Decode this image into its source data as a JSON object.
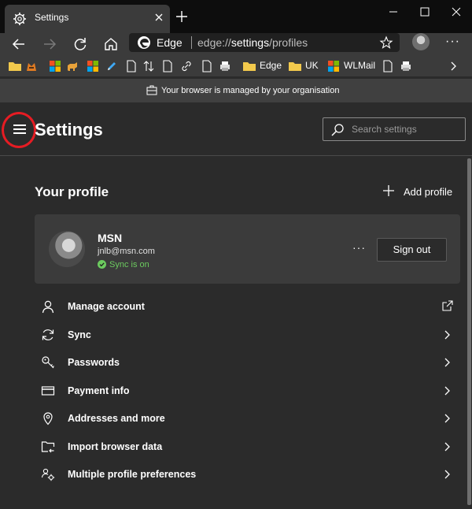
{
  "tab": {
    "title": "Settings"
  },
  "address_bar": {
    "brand": "Edge",
    "url_prefix": "edge://",
    "url_bold": "settings",
    "url_suffix": "/profiles"
  },
  "favorites": [
    {
      "label": "Edge",
      "icon": "folder-icon"
    },
    {
      "label": "UK",
      "icon": "folder-icon"
    },
    {
      "label": "WLMail",
      "icon": "windows-logo-icon"
    }
  ],
  "managed_banner": "Your browser is managed by your organisation",
  "header": {
    "title": "Settings",
    "search_placeholder": "Search settings"
  },
  "profile_section": {
    "heading": "Your profile",
    "add_profile": "Add profile",
    "name": "MSN",
    "email": "jnlb@msn.com",
    "sync_status": "Sync is on",
    "more": "···",
    "sign_out": "Sign out"
  },
  "settings_items": [
    {
      "label": "Manage account",
      "icon": "person-icon",
      "action": "external-link-icon"
    },
    {
      "label": "Sync",
      "icon": "sync-icon",
      "action": "chevron-right-icon"
    },
    {
      "label": "Passwords",
      "icon": "key-icon",
      "action": "chevron-right-icon"
    },
    {
      "label": "Payment info",
      "icon": "credit-card-icon",
      "action": "chevron-right-icon"
    },
    {
      "label": "Addresses and more",
      "icon": "location-pin-icon",
      "action": "chevron-right-icon"
    },
    {
      "label": "Import browser data",
      "icon": "import-folder-icon",
      "action": "chevron-right-icon"
    },
    {
      "label": "Multiple profile preferences",
      "icon": "profiles-gear-icon",
      "action": "chevron-right-icon"
    }
  ],
  "colors": {
    "background": "#2b2b2b",
    "card": "#3b3b3b",
    "sync_green": "#6ccb5f",
    "highlight_ring": "#e61c23"
  }
}
